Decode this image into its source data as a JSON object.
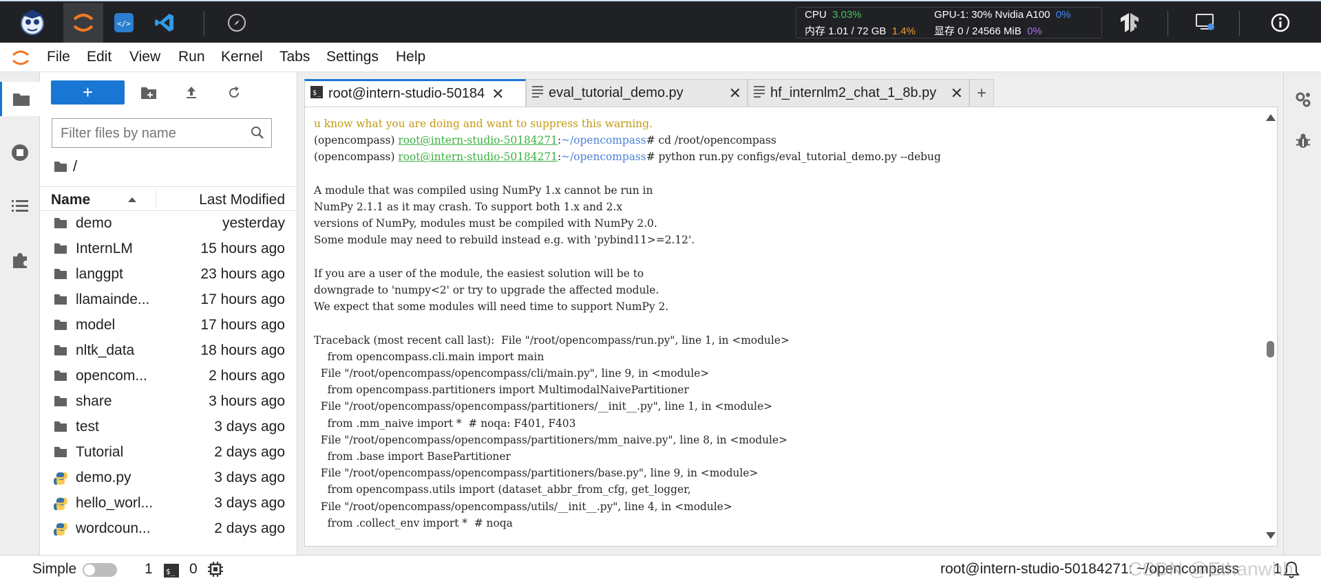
{
  "topbar": {
    "cpu_label": "CPU",
    "cpu_value": "3.03%",
    "mem_label": "内存 1.01 / 72 GB",
    "mem_value": "1.4%",
    "gpu_label": "GPU-1: 30% Nvidia A100",
    "gpu_value": "0%",
    "vram_label": "显存 0 / 24566 MiB",
    "vram_value": "0%"
  },
  "menu": [
    "File",
    "Edit",
    "View",
    "Run",
    "Kernel",
    "Tabs",
    "Settings",
    "Help"
  ],
  "filebrowser": {
    "new_label": "+",
    "filter_placeholder": "Filter files by name",
    "breadcrumb": "/",
    "col_name": "Name",
    "col_modified": "Last Modified",
    "files": [
      {
        "name": "demo",
        "modified": "yesterday",
        "type": "folder"
      },
      {
        "name": "InternLM",
        "modified": "15 hours ago",
        "type": "folder"
      },
      {
        "name": "langgpt",
        "modified": "23 hours ago",
        "type": "folder"
      },
      {
        "name": "llamainde...",
        "modified": "17 hours ago",
        "type": "folder"
      },
      {
        "name": "model",
        "modified": "17 hours ago",
        "type": "folder"
      },
      {
        "name": "nltk_data",
        "modified": "18 hours ago",
        "type": "folder"
      },
      {
        "name": "opencom...",
        "modified": "2 hours ago",
        "type": "folder"
      },
      {
        "name": "share",
        "modified": "3 hours ago",
        "type": "folder"
      },
      {
        "name": "test",
        "modified": "3 days ago",
        "type": "folder"
      },
      {
        "name": "Tutorial",
        "modified": "2 days ago",
        "type": "folder"
      },
      {
        "name": "demo.py",
        "modified": "3 days ago",
        "type": "python"
      },
      {
        "name": "hello_worl...",
        "modified": "3 days ago",
        "type": "python"
      },
      {
        "name": "wordcoun...",
        "modified": "2 days ago",
        "type": "python"
      }
    ]
  },
  "tabs": [
    {
      "label": "root@intern-studio-50184",
      "type": "terminal",
      "active": true
    },
    {
      "label": "eval_tutorial_demo.py",
      "type": "file",
      "active": false
    },
    {
      "label": "hf_internlm2_chat_1_8b.py",
      "type": "file",
      "active": false
    }
  ],
  "terminal": {
    "warning_tail": "u know what you are doing and want to suppress this warning.",
    "prompt_prefix": "(opencompass) ",
    "prompt_user": "root@intern-studio-50184271",
    "prompt_sep": ":",
    "prompt_path": "~/opencompass",
    "cmd1": "# cd /root/opencompass",
    "cmd2": "# python run.py configs/eval_tutorial_demo.py --debug",
    "lines": [
      "",
      "A module that was compiled using NumPy 1.x cannot be run in",
      "NumPy 2.1.1 as it may crash. To support both 1.x and 2.x",
      "versions of NumPy, modules must be compiled with NumPy 2.0.",
      "Some module may need to rebuild instead e.g. with 'pybind11>=2.12'.",
      "",
      "If you are a user of the module, the easiest solution will be to",
      "downgrade to 'numpy<2' or try to upgrade the affected module.",
      "We expect that some modules will need time to support NumPy 2.",
      "",
      "Traceback (most recent call last):  File \"/root/opencompass/run.py\", line 1, in <module>",
      "    from opencompass.cli.main import main",
      "  File \"/root/opencompass/opencompass/cli/main.py\", line 9, in <module>",
      "    from opencompass.partitioners import MultimodalNaivePartitioner",
      "  File \"/root/opencompass/opencompass/partitioners/__init__.py\", line 1, in <module>",
      "    from .mm_naive import *  # noqa: F401, F403",
      "  File \"/root/opencompass/opencompass/partitioners/mm_naive.py\", line 8, in <module>",
      "    from .base import BasePartitioner",
      "  File \"/root/opencompass/opencompass/partitioners/base.py\", line 9, in <module>",
      "    from opencompass.utils import (dataset_abbr_from_cfg, get_logger,",
      "  File \"/root/opencompass/opencompass/utils/__init__.py\", line 4, in <module>",
      "    from .collect_env import *  # noqa"
    ]
  },
  "statusbar": {
    "mode": "Simple",
    "count1": "1",
    "count2": "0",
    "terminal_name": "root@intern-studio-50184271: ~/opencompass",
    "right_count": "1",
    "watermark": "CSDN @Ethanwhh"
  }
}
